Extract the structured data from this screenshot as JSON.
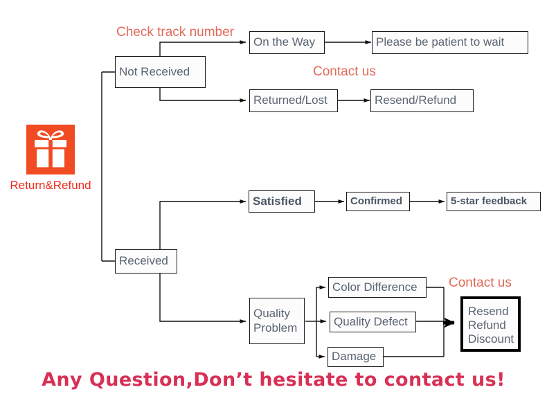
{
  "diagram": {
    "title": "Return&Refund flowchart",
    "root": {
      "icon": "gift-box-icon",
      "caption": "Return&Refund",
      "color": "#f04b23",
      "caption_color": "#ee2b1c"
    },
    "annotations": [
      {
        "id": "check-track-number",
        "text": "Check track number",
        "color": "#e06a58"
      },
      {
        "id": "contact-us-top",
        "text": "Contact us",
        "color": "#e06a58"
      },
      {
        "id": "contact-us-bottom",
        "text": "Contact us",
        "color": "#e06a58"
      }
    ],
    "nodes": {
      "not_received": "Not Received",
      "on_the_way": "On the Way",
      "please_wait": "Please be patient to wait",
      "returned_lost": "Returned/Lost",
      "resend_refund": "Resend/Refund",
      "received": "Received",
      "satisfied": "Satisfied",
      "confirmed": "Confirmed",
      "five_star": "5-star feedback",
      "quality_problem_line1": "Quality",
      "quality_problem_line2": "Problem",
      "color_difference": "Color Difference",
      "quality_defect": "Quality Defect",
      "damage": "Damage",
      "outcome_line1": "Resend",
      "outcome_line2": "Refund",
      "outcome_line3": "Discount"
    },
    "footer": "Any Question,Don’t hesitate to contact us!"
  }
}
